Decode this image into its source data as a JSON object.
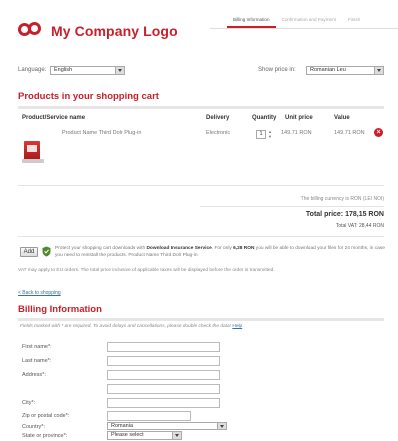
{
  "header": {
    "logo_text": "My Company Logo",
    "steps": [
      "Billing Information",
      "Confirmation and Payment",
      "Finish"
    ]
  },
  "toolbar": {
    "language_label": "Language:",
    "language_value": "English",
    "price_label": "Show price in:",
    "price_value": "Romanian Leu"
  },
  "cart": {
    "title": "Products in your shopping cart",
    "columns": {
      "product": "Product/Service name",
      "delivery": "Delivery",
      "quantity": "Quantity",
      "unit_price": "Unit price",
      "value": "Value"
    },
    "items": [
      {
        "name": "Product Name Third Dolr Plug-in",
        "delivery": "Electronic",
        "quantity": "1",
        "unit_price": "149.71 RON",
        "value": "149.71 RON"
      }
    ],
    "billing_currency": "The billing currency is RON (LEI NOI)",
    "total_price": "Total price: 178,15 RON",
    "total_vat": "Total VAT: 28,44 RON"
  },
  "insurance": {
    "add_label": "Add",
    "text_prefix": "Protect your shopping cart downloads with ",
    "service_name": "Download Insurance Service",
    "text_middle": ". For only ",
    "price": "6,28 RON",
    "text_suffix": " you will be able to download your files for 24 months, in case you need to reinstall the products. Product Name Third Dolr Plug-in",
    "vat_note": "VAT may apply to EU orders. The total price inclusive of applicable taxes will be displayed before the order is transmitted."
  },
  "links": {
    "back": "< Back to shopping"
  },
  "billing": {
    "title": "Billing Information",
    "note": "Fields marked with * are required. To avoid delays and cancellations, please double check the data!",
    "note_link": "Help",
    "fields": {
      "first_name": "First name*:",
      "last_name": "Last name*:",
      "address": "Address*:",
      "city": "City*:",
      "zip": "Zip or postal code*:",
      "country": "Country*:",
      "state": "State or province*:"
    },
    "country_value": "Romania",
    "state_value": "Please select"
  },
  "colors": {
    "brand": "#c8202b",
    "link": "#3a6ea8"
  },
  "icons": {
    "logo": "logo-rings-icon",
    "remove": "remove-circle-icon",
    "shield": "shield-icon",
    "product": "product-box-icon"
  }
}
